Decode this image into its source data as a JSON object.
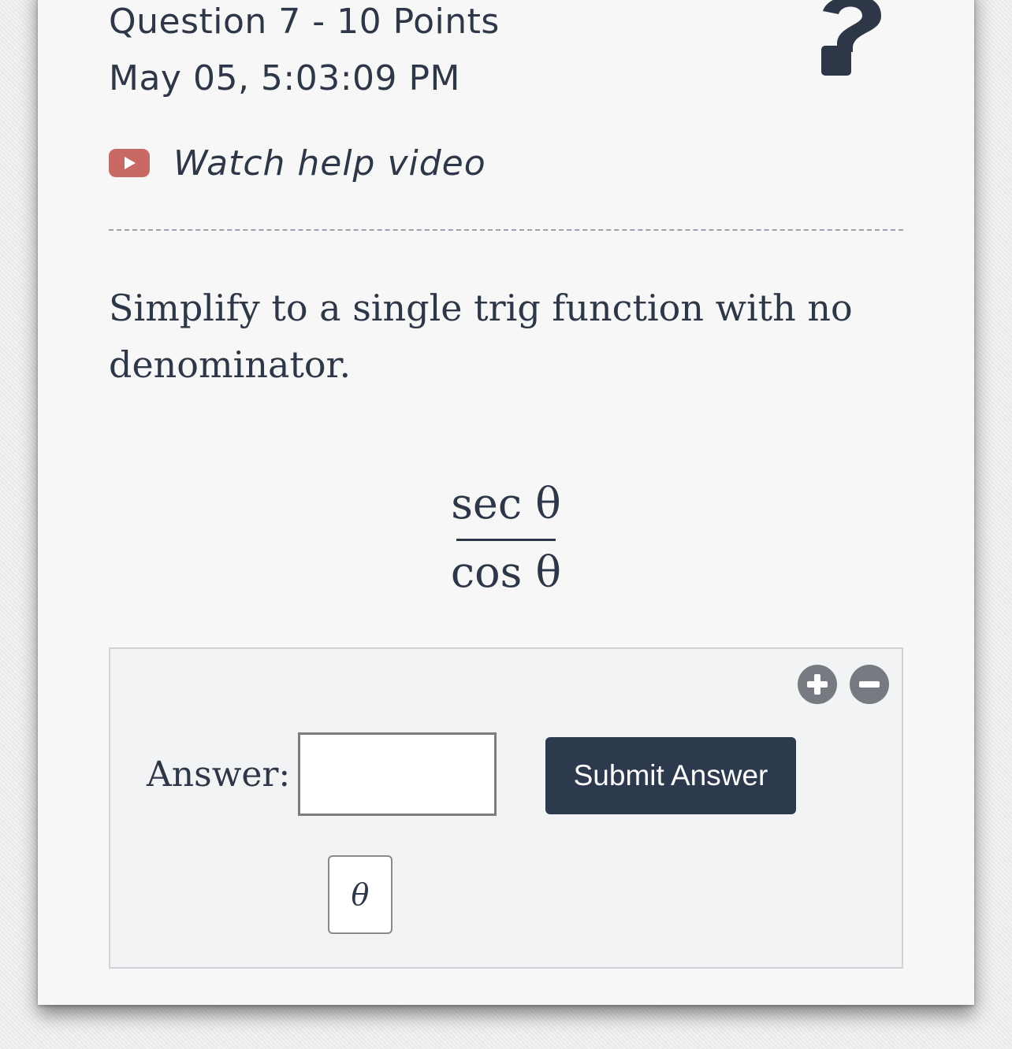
{
  "header": {
    "question_line": "Question 7 - 10 Points",
    "timestamp": "May 05, 5:03:09 PM",
    "help_icon": "question-mark-icon"
  },
  "help_video": {
    "label": "Watch help video",
    "icon": "youtube-play-icon",
    "icon_color": "#c86963"
  },
  "problem": {
    "prompt": "Simplify to a single trig function with no denominator.",
    "expression": {
      "numerator": "sec θ",
      "denominator": "cos θ"
    }
  },
  "answer_panel": {
    "zoom_in_icon": "plus-circle-icon",
    "zoom_out_icon": "minus-circle-icon",
    "answer_label": "Answer:",
    "answer_value": "",
    "submit_label": "Submit Answer",
    "symbol_key": "θ"
  },
  "colors": {
    "text": "#2d3748",
    "button_bg": "#2d3a4d",
    "panel_bg": "#f2f3f5"
  }
}
